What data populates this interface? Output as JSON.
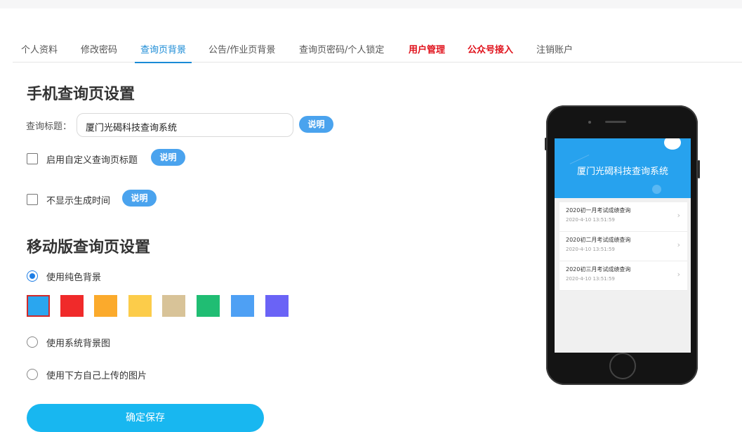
{
  "tabs": [
    {
      "label": "个人资料"
    },
    {
      "label": "修改密码"
    },
    {
      "label": "查询页背景"
    },
    {
      "label": "公告/作业页背景"
    },
    {
      "label": "查询页密码/个人锁定"
    },
    {
      "label": "用户管理"
    },
    {
      "label": "公众号接入"
    },
    {
      "label": "注销账户"
    }
  ],
  "mobile_section": {
    "heading": "手机查询页设置",
    "title_label": "查询标题：",
    "title_value": "厦门光碣科技查询系统",
    "explain_label": "说明",
    "custom_title_label": "启用自定义查询页标题",
    "hide_time_label": "不显示生成时间"
  },
  "mobile_bg_section": {
    "heading": "移动版查询页设置",
    "option_solid": "使用纯色背景",
    "option_system": "使用系统背景图",
    "option_upload": "使用下方自己上传的图片",
    "selected_option": "使用纯色背景",
    "selected_color": "#2aa6ef"
  },
  "colors": [
    "#2aa6ef",
    "#f02a2a",
    "#fbaa2c",
    "#fccc4a",
    "#d8c398",
    "#20bd73",
    "#4ea0f4",
    "#6a63f6"
  ],
  "save_label": "确定保存",
  "preview": {
    "title": "厦门光碣科技查询系统",
    "items": [
      {
        "title": "2020初一月考试成绩查询",
        "date": "2020-4-10 13:51:59"
      },
      {
        "title": "2020初二月考试成绩查询",
        "date": "2020-4-10 13:51:59"
      },
      {
        "title": "2020初三月考试成绩查询",
        "date": "2020-4-10 13:51:59"
      }
    ]
  }
}
